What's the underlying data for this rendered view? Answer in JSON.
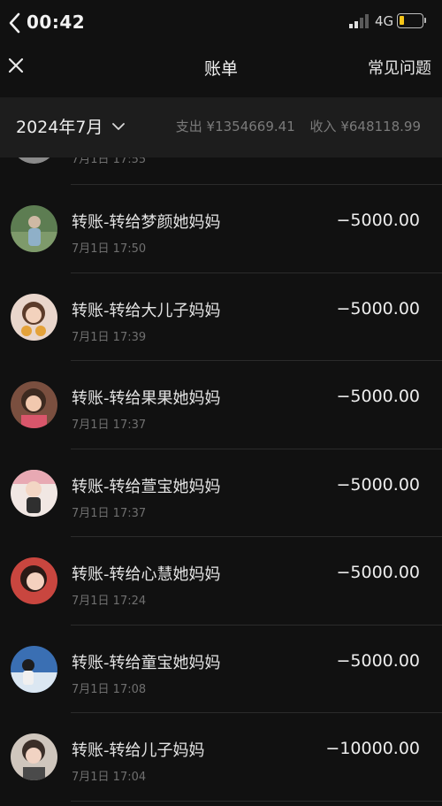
{
  "status_bar": {
    "time": "00:42",
    "network": "4G",
    "battery_level": 0.2,
    "battery_color": "#f5c518"
  },
  "nav": {
    "title": "账单",
    "faq": "常见问题"
  },
  "summary": {
    "month": "2024年7月",
    "expense_label": "支出",
    "expense_value": "¥1354669.41",
    "income_label": "收入",
    "income_value": "¥648118.99"
  },
  "partial_top_row": {
    "time": "7月1日 17:55"
  },
  "transactions": [
    {
      "desc": "转账-转给梦颜她妈妈",
      "time": "7月1日 17:50",
      "amount": "−5000.00"
    },
    {
      "desc": "转账-转给大儿子妈妈",
      "time": "7月1日 17:39",
      "amount": "−5000.00"
    },
    {
      "desc": "转账-转给果果她妈妈",
      "time": "7月1日 17:37",
      "amount": "−5000.00"
    },
    {
      "desc": "转账-转给萱宝她妈妈",
      "time": "7月1日 17:37",
      "amount": "−5000.00"
    },
    {
      "desc": "转账-转给心慧她妈妈",
      "time": "7月1日 17:24",
      "amount": "−5000.00"
    },
    {
      "desc": "转账-转给童宝她妈妈",
      "time": "7月1日 17:08",
      "amount": "−5000.00"
    },
    {
      "desc": "转账-转给儿子妈妈",
      "time": "7月1日 17:04",
      "amount": "−10000.00"
    }
  ]
}
